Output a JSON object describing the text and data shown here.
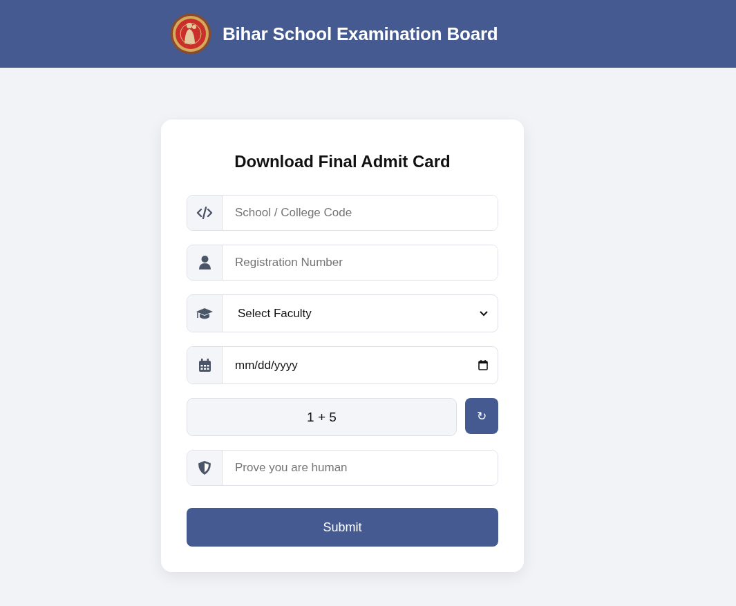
{
  "header": {
    "title": "Bihar School Examination Board"
  },
  "form": {
    "title": "Download Final Admit Card",
    "fields": [
      {
        "kind": "text",
        "placeholder": "School / College Code"
      },
      {
        "kind": "text",
        "placeholder": "Registration Number"
      },
      {
        "kind": "select",
        "value": "Select Faculty"
      },
      {
        "kind": "date",
        "value": "mm/dd/yyyy"
      }
    ],
    "captcha": {
      "question": "1 + 5",
      "refresh": "↻"
    },
    "answer": {
      "placeholder": "Prove you are human"
    },
    "submit": "Submit"
  }
}
